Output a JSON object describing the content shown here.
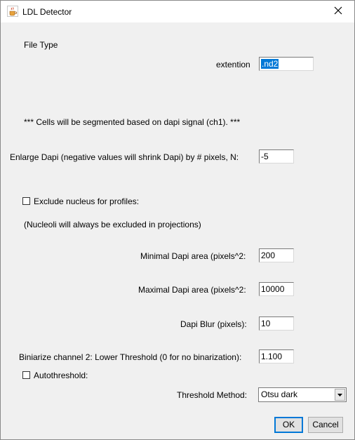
{
  "window": {
    "title": "LDL Detector",
    "icon": "java-cup-icon",
    "close_icon": "close-icon"
  },
  "form": {
    "file_type_label": "File Type",
    "extension_label": "extention",
    "extension_value": ".nd2",
    "segmentation_note": "*** Cells will be segmented based on  dapi signal (ch1). ***",
    "enlarge_label": "Enlarge Dapi (negative values will shrink Dapi) by # pixels, N:",
    "enlarge_value": "-5",
    "exclude_nucleus_label": "Exclude nucleus for profiles:",
    "exclude_nucleus_checked": false,
    "nucleoli_note": "(Nucleoli will always be excluded in projections)",
    "min_area_label": "Minimal Dapi area (pixels^2:",
    "min_area_value": "200",
    "max_area_label": "Maximal Dapi area (pixels^2:",
    "max_area_value": "10000",
    "blur_label": "Dapi Blur (pixels):",
    "blur_value": "10",
    "binarize_label": "Biniarize channel 2: Lower Threshold (0 for no binarization):",
    "binarize_value": "1.100",
    "autothreshold_label": "Autothreshold:",
    "autothreshold_checked": false,
    "threshold_method_label": "Threshold Method:",
    "threshold_method_value": "Otsu dark"
  },
  "buttons": {
    "ok": "OK",
    "cancel": "Cancel"
  }
}
